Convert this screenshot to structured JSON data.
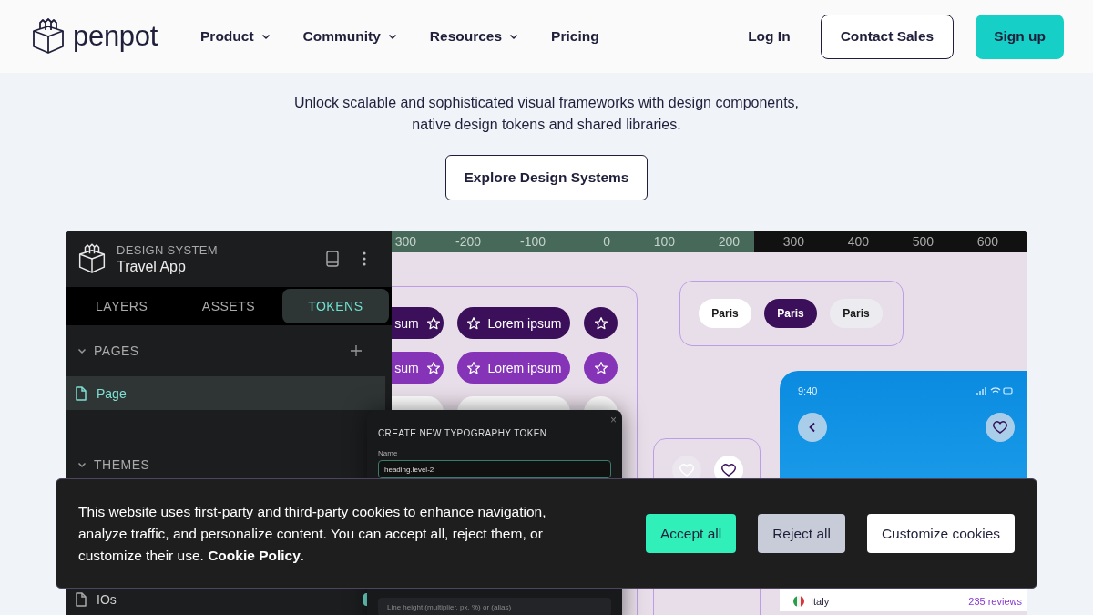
{
  "nav": {
    "logo": "penpot",
    "menu": [
      {
        "label": "Product",
        "dropdown": true
      },
      {
        "label": "Community",
        "dropdown": true
      },
      {
        "label": "Resources",
        "dropdown": true
      },
      {
        "label": "Pricing",
        "dropdown": false
      }
    ],
    "login": "Log In",
    "contact": "Contact Sales",
    "signup": "Sign up"
  },
  "hero": {
    "text": "Unlock scalable and sophisticated visual frameworks with design components, native design tokens and shared libraries.",
    "button": "Explore Design Systems"
  },
  "app": {
    "eyebrow": "DESIGN SYSTEM",
    "title": "Travel App",
    "tabs": [
      {
        "label": "LAYERS",
        "selected": false
      },
      {
        "label": "ASSETS",
        "selected": false
      },
      {
        "label": "TOKENS",
        "selected": true
      }
    ],
    "pages_section": {
      "label": "PAGES",
      "expanded": true
    },
    "pages": [
      {
        "label": "Page",
        "selected": true
      }
    ],
    "themes_section": {
      "label": "THEMES",
      "expanded": true
    },
    "sets": [
      {
        "label": "IOs",
        "checked": true
      }
    ],
    "ruler": [
      {
        "label": "300",
        "highlighted": true
      },
      {
        "label": "-200",
        "highlighted": true
      },
      {
        "label": "-100",
        "highlighted": true
      },
      {
        "label": "0",
        "highlighted": true
      },
      {
        "label": "100",
        "highlighted": true
      },
      {
        "label": "200",
        "highlighted": true
      },
      {
        "label": "300",
        "highlighted": false
      },
      {
        "label": "400",
        "highlighted": false
      },
      {
        "label": "500",
        "highlighted": false
      },
      {
        "label": "600",
        "highlighted": false
      }
    ],
    "button_rows": [
      {
        "kind": "dark",
        "partial": "sum",
        "label": "Lorem ipsum"
      },
      {
        "kind": "purple",
        "partial": "sum",
        "label": "Lorem ipsum"
      },
      {
        "kind": "light"
      }
    ],
    "chips": [
      {
        "label": "Paris",
        "kind": "default"
      },
      {
        "label": "Paris",
        "kind": "selected"
      },
      {
        "label": "Paris",
        "kind": "muted"
      }
    ],
    "hearts": [
      {
        "disabled": true
      },
      {
        "disabled": false
      }
    ],
    "photo_card": {
      "time": "9:40",
      "country": "Italy",
      "reviews": "235 reviews"
    },
    "dialog": {
      "close": "×",
      "title": "CREATE NEW TYPOGRAPHY TOKEN",
      "name_label": "Name",
      "name_value": "heading.level-2",
      "line_height_placeholder": "Line height (multiplier, px, %) or (alias)"
    }
  },
  "cookie": {
    "text": "This website uses first-party and third-party cookies to enhance navigation, analyze traffic, and personalize content. You can accept all, reject them, or customize their use. ",
    "link": "Cookie Policy",
    "after": ".",
    "buttons": [
      {
        "label": "Accept all",
        "kind": "primary"
      },
      {
        "label": "Reject all",
        "kind": "secondary"
      },
      {
        "label": "Customize cookies",
        "kind": "outline"
      }
    ]
  }
}
